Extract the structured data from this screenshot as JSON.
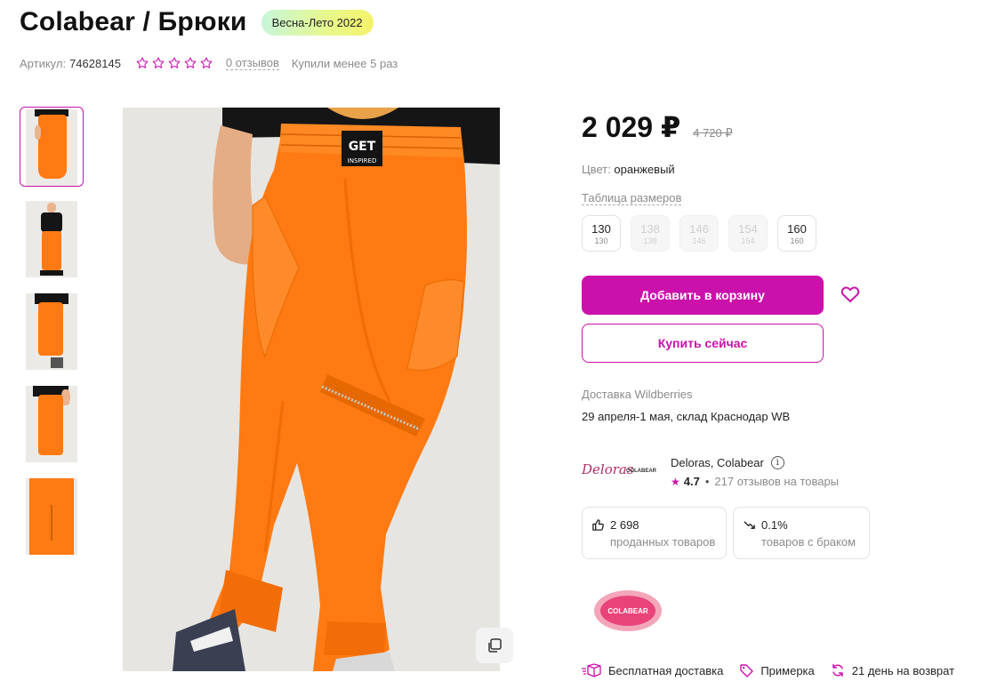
{
  "product": {
    "title": "Colabear / Брюки",
    "season_badge": "Весна-Лето 2022",
    "sku_label": "Артикул:",
    "sku_value": "74628145",
    "rating_stars": 0,
    "reviews_link": "0 отзывов",
    "bought_text": "Купили менее 5 раз"
  },
  "gallery": {
    "thumb_count": 5,
    "active_index": 0,
    "tshirt_print": "GET INSPIRED"
  },
  "price": {
    "current": "2 029 ₽",
    "old": "4 720 ₽"
  },
  "color": {
    "label": "Цвет:",
    "value": "оранжевый"
  },
  "size_table_link": "Таблица размеров",
  "sizes": [
    {
      "label": "130",
      "sub": "130",
      "available": true
    },
    {
      "label": "138",
      "sub": "138",
      "available": false
    },
    {
      "label": "146",
      "sub": "146",
      "available": false
    },
    {
      "label": "154",
      "sub": "154",
      "available": false
    },
    {
      "label": "160",
      "sub": "160",
      "available": true
    }
  ],
  "buttons": {
    "add_to_cart": "Добавить в корзину",
    "buy_now": "Купить сейчас"
  },
  "delivery": {
    "label": "Доставка Wildberries",
    "date": "29 апреля-1 мая, склад Краснодар WB"
  },
  "seller": {
    "name": "Deloras, Colabear",
    "logo_text": "Deloras",
    "logo_sub": "COLABEAR",
    "rating": "4.7",
    "reviews": "217 отзывов на товары"
  },
  "stats": {
    "sold_count": "2 698",
    "sold_label": "проданных товаров",
    "defect_rate": "0.1%",
    "defect_label": "товаров с браком"
  },
  "brand_logo_text": "COLABEAR",
  "features": [
    {
      "icon": "box-icon",
      "label": "Бесплатная доставка"
    },
    {
      "icon": "tag-icon",
      "label": "Примерка"
    },
    {
      "icon": "refresh-icon",
      "label": "21 день на возврат"
    }
  ],
  "colors": {
    "accent": "#cb11ab",
    "pants": "#ff7a12"
  }
}
